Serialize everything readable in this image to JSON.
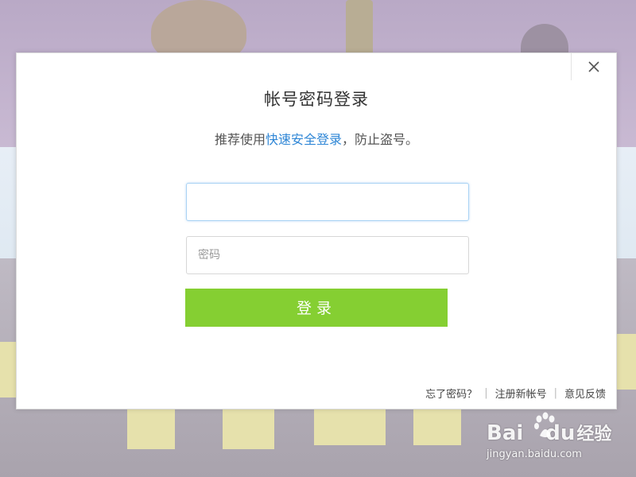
{
  "dialog": {
    "title": "帐号密码登录",
    "subtitle_prefix": "推荐使用",
    "subtitle_link": "快速安全登录",
    "subtitle_suffix": "，防止盗号。",
    "account_input": {
      "value": "",
      "placeholder": ""
    },
    "password_input": {
      "value": "",
      "placeholder": "密码"
    },
    "login_button_label": "登录",
    "footer_links": {
      "forgot_password": "忘了密码？",
      "register": "注册新帐号",
      "feedback": "意见反馈",
      "separator": "|"
    },
    "close_icon": "close-icon"
  },
  "watermark": {
    "brand_part1": "Bai",
    "brand_part2": "du",
    "brand_cn": "经验",
    "url": "jingyan.baidu.com"
  },
  "colors": {
    "accent_green": "#85cf32",
    "link_blue": "#2e86d6",
    "focus_border": "#a9d2f4"
  }
}
